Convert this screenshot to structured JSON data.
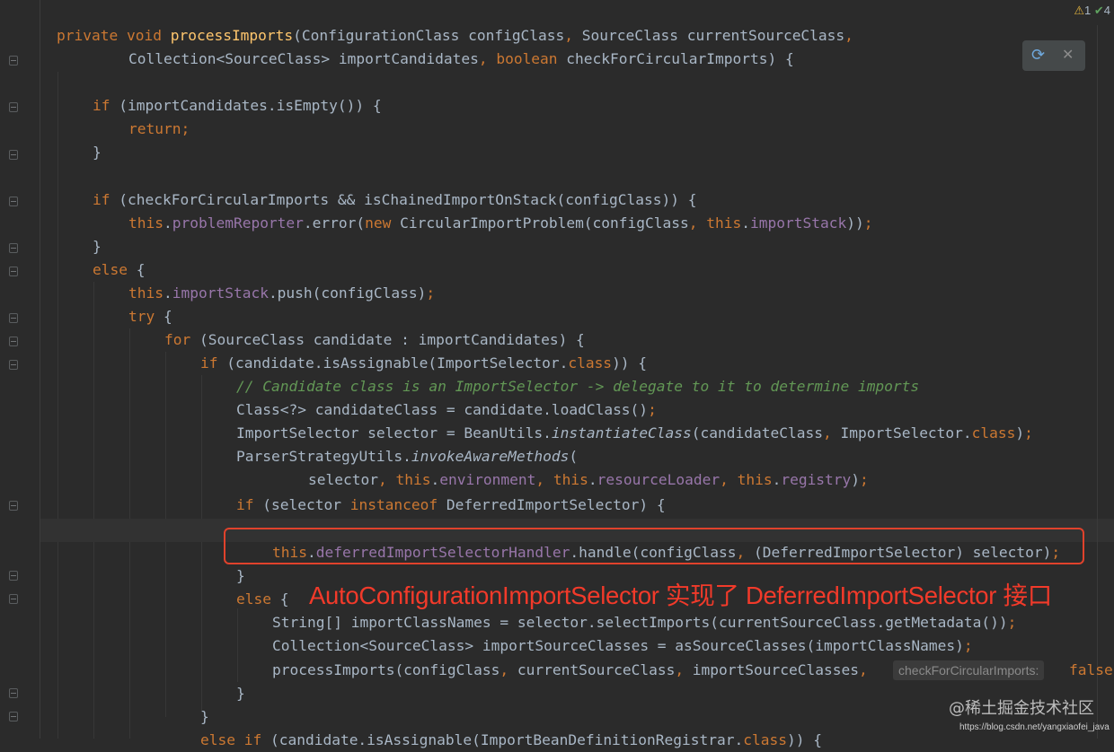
{
  "status": {
    "warnings": "1",
    "checks": "4",
    "warning_icon": "warning-triangle-icon",
    "check_icon": "double-check-icon"
  },
  "floating_toolbar": {
    "icon": "refresh-maven-icon",
    "close": "✕"
  },
  "code": {
    "l1": {
      "kw1": "private",
      "kw2": "void",
      "fn": "processImports",
      "rest1": "(ConfigurationClass configClass",
      "c1": ",",
      "rest2": " SourceClass currentSourceClass",
      "c2": ","
    },
    "l2": {
      "t1": "Collection<SourceClass> importCandidates",
      "c": ",",
      "kw": "boolean",
      "t2": " checkForCircularImports) {"
    },
    "l3": {
      "kw": "if",
      "t": " (importCandidates.isEmpty()) {"
    },
    "l4": {
      "kw": "return;"
    },
    "l5": {
      "t": "}"
    },
    "l6": {
      "kw": "if",
      "t": " (checkForCircularImports && isChainedImportOnStack(configClass)) {"
    },
    "l7": {
      "kw1": "this",
      "dot": ".",
      "fld1": "problemReporter",
      "t1": ".error(",
      "kw2": "new",
      "t2": " CircularImportProblem(configClass",
      "c": ",",
      "kw3": "this",
      "dot2": ".",
      "fld2": "importStack",
      "t3": "))",
      "semi": ";"
    },
    "l8": {
      "t": "}"
    },
    "l9": {
      "kw": "else",
      "t": " {"
    },
    "l10": {
      "kw": "this",
      "dot": ".",
      "fld": "importStack",
      "t": ".push(configClass)",
      "semi": ";"
    },
    "l11": {
      "kw": "try",
      "t": " {"
    },
    "l12": {
      "kw": "for",
      "t": " (SourceClass candidate : importCandidates) {"
    },
    "l13": {
      "kw": "if",
      "t1": " (candidate.isAssignable(ImportSelector.",
      "kw2": "class",
      "t2": ")) {"
    },
    "l14": {
      "cm": "// Candidate class is an ImportSelector -> delegate to it to determine imports"
    },
    "l15": {
      "t": "Class<?> candidateClass = candidate.loadClass()",
      "semi": ";"
    },
    "l16": {
      "t1": "ImportSelector selector = BeanUtils.",
      "it": "instantiateClass",
      "t2": "(candidateClass",
      "c": ",",
      "t3": " ImportSelector.",
      "kw": "class",
      "t4": ")",
      "semi": ";"
    },
    "l17": {
      "t1": "ParserStrategyUtils.",
      "it": "invokeAwareMethods",
      "t2": "("
    },
    "l18": {
      "t1": "selector",
      "c1": ",",
      "kw1": "this",
      "d1": ".",
      "f1": "environment",
      "c2": ",",
      "kw2": "this",
      "d2": ".",
      "f2": "resourceLoader",
      "c3": ",",
      "kw3": "this",
      "d3": ".",
      "f3": "registry",
      "t2": ")",
      "semi": ";"
    },
    "l19": {
      "kw1": "if",
      "t1": " (selector ",
      "kw2": "instanceof",
      "t2": " DeferredImportSelector) {"
    },
    "l21": {
      "kw": "this",
      "dot": ".",
      "fld": "deferredImportSelectorHandler",
      "t1": ".handle(configClass",
      "c": ",",
      "t2": " (DeferredImportSelector) selector)",
      "semi": ";"
    },
    "l22": {
      "t": "}"
    },
    "l23": {
      "kw": "else",
      "t": " {"
    },
    "l24": {
      "t": "String[] importClassNames = selector.selectImports(currentSourceClass.getMetadata())",
      "semi": ";"
    },
    "l25": {
      "t": "Collection<SourceClass> importSourceClasses = asSourceClasses(importClassNames)",
      "semi": ";"
    },
    "l26": {
      "t1": "processImports(configClass",
      "c1": ",",
      "t2": " currentSourceClass",
      "c2": ",",
      "t3": " importSourceClasses",
      "c3": ","
    },
    "l27": {
      "t": "}"
    },
    "l28": {
      "t": "}"
    },
    "l29": {
      "kw1": "else",
      "kw2": "if",
      "t1": " (candidate.isAssignable(ImportBeanDefinitionRegistrar.",
      "kw3": "class",
      "t2": ")) {"
    }
  },
  "inlay_hint": {
    "name": "checkForCircularImports:",
    "value": "false"
  },
  "annotation": "AutoConfigurationImportSelector 实现了 DeferredImportSelector 接口",
  "watermark": {
    "site": "@稀土掘金技术社区",
    "url": "https://blog.csdn.net/yangxiaofei_java"
  }
}
